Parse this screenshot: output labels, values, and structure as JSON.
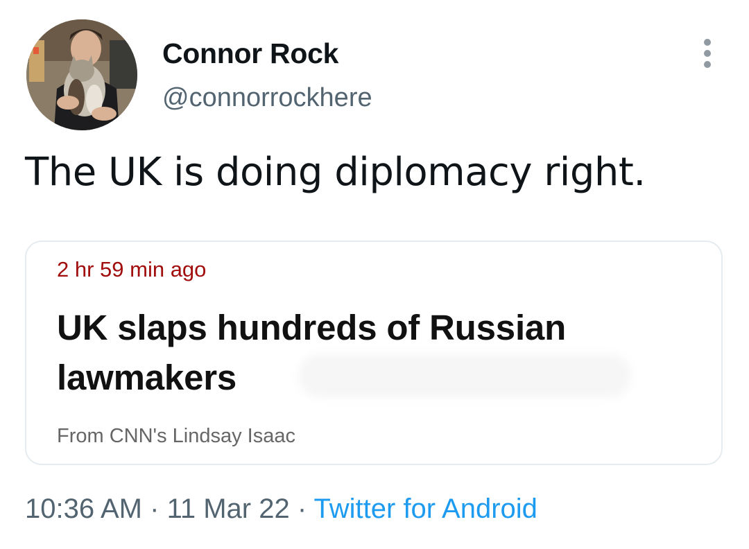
{
  "author": {
    "display_name": "Connor Rock",
    "handle": "@connorrockhere",
    "avatar_icon": "profile-photo-person-holding-cat"
  },
  "menu": {
    "icon": "more-options-vertical-dots-icon"
  },
  "tweet": {
    "text": "The UK is doing diplomacy right."
  },
  "card": {
    "time_ago": "2 hr 59 min ago",
    "headline": "UK slaps hundreds of Russian lawmakers",
    "source": "From CNN's Lindsay Isaac"
  },
  "meta": {
    "time": "10:36 AM",
    "separator": " · ",
    "date": "11 Mar 22",
    "source_app": "Twitter for Android"
  },
  "colors": {
    "link": "#1d9bf0",
    "secondary_text": "#536471",
    "card_time": "#a10d0d",
    "card_border": "#e6ecf0"
  }
}
